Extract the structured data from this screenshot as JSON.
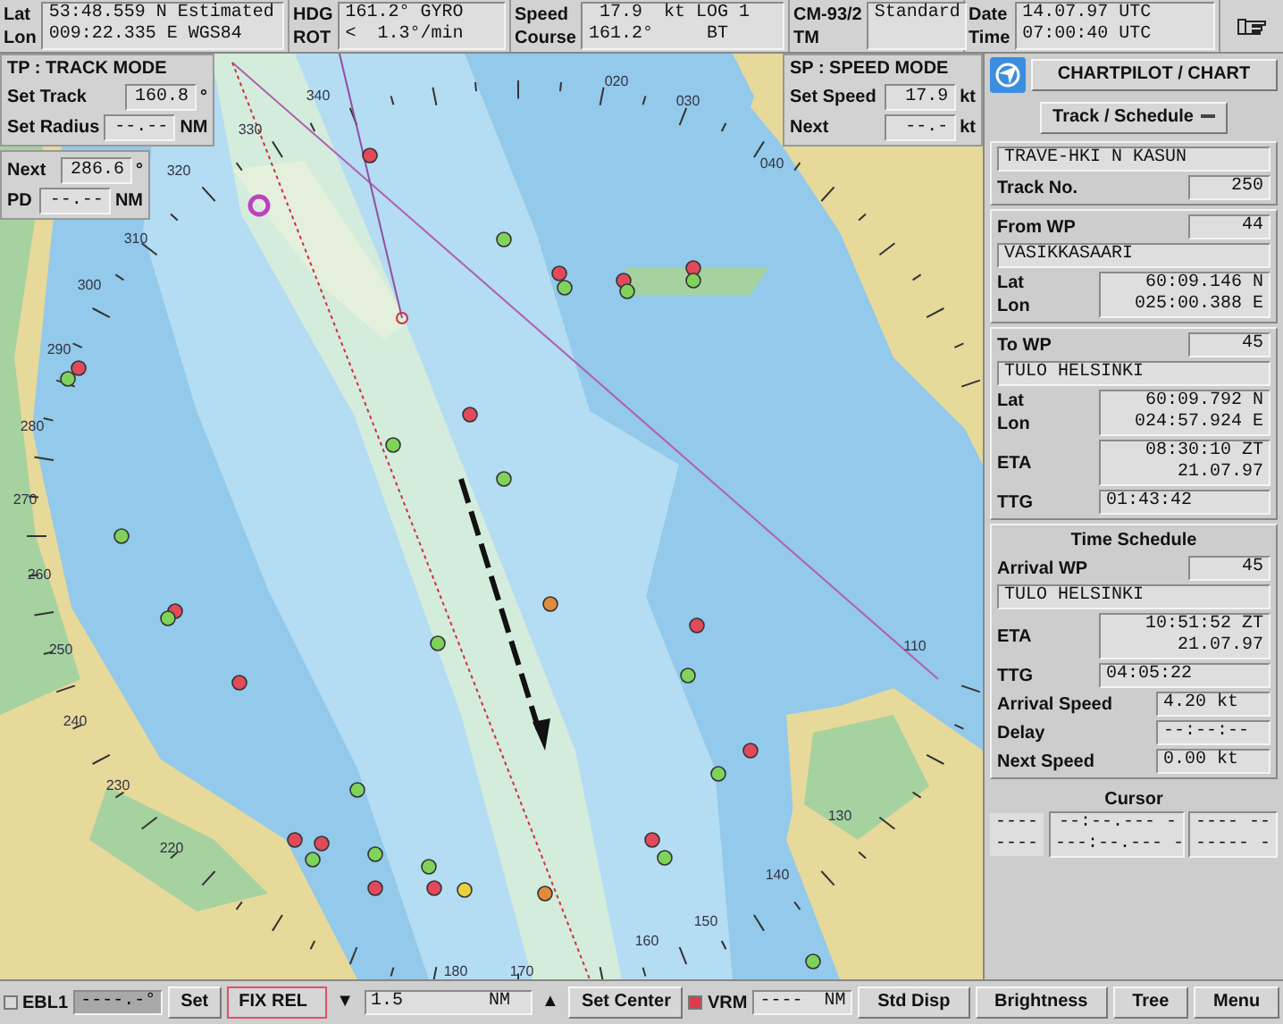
{
  "top_bar": [
    {
      "labels": [
        "Lat",
        "Lon"
      ],
      "values": [
        "53:48.559 N Estimated",
        "009:22.335 E WGS84"
      ]
    },
    {
      "labels": [
        "HDG",
        "ROT"
      ],
      "values": [
        "161.2° GYRO",
        "<  1.3°/min"
      ]
    },
    {
      "labels": [
        "Speed",
        "Course"
      ],
      "values": [
        " 17.9  kt LOG 1",
        "161.2°     BT"
      ]
    },
    {
      "labels": [
        "CM-93/2",
        "TM"
      ],
      "values": [
        "Standard"
      ]
    },
    {
      "labels": [
        "Date",
        "Time"
      ],
      "values": [
        "14.07.97 UTC",
        "07:00:40 UTC"
      ]
    }
  ],
  "track_mode": {
    "title": "TP :  TRACK MODE",
    "rows": [
      {
        "label": "Set Track",
        "value": "160.8",
        "unit": "°"
      },
      {
        "label": "Set Radius",
        "value": "--.--",
        "unit": "NM"
      }
    ]
  },
  "next_panel": {
    "next": {
      "label": "Next",
      "value": "286.6",
      "unit": "°"
    },
    "pd": {
      "label": "PD",
      "value": "--.--",
      "unit": "NM"
    }
  },
  "speed_mode": {
    "title": "SP : SPEED MODE",
    "rows": [
      {
        "label": "Set Speed",
        "value": "17.9",
        "unit": "kt"
      },
      {
        "label": "Next",
        "value": "--.-",
        "unit": "kt"
      }
    ]
  },
  "compass_labels": [
    "340",
    "330",
    "320",
    "310",
    "300",
    "290",
    "280",
    "270",
    "260",
    "250",
    "240",
    "230",
    "220",
    "020",
    "030",
    "040",
    "110",
    "130",
    "140",
    "150",
    "160",
    "170",
    "180"
  ],
  "chartpilot": {
    "title": "CHARTPILOT / CHART",
    "dropdown": "Track / Schedule"
  },
  "track": {
    "name": "TRAVE-HKI N KASUN",
    "number_label": "Track No.",
    "number": "250"
  },
  "from_wp": {
    "label": "From WP",
    "number": "44",
    "name": "VASIKKASAARI",
    "lat_label": "Lat",
    "lon_label": "Lon",
    "lat": "60:09.146 N",
    "lon": "025:00.388 E"
  },
  "to_wp": {
    "label": "To WP",
    "number": "45",
    "name": "TULO HELSINKI",
    "lat_label": "Lat",
    "lon_label": "Lon",
    "lat": "60:09.792 N",
    "lon": "024:57.924 E",
    "eta_label": "ETA",
    "eta": [
      "08:30:10 ZT",
      "21.07.97"
    ],
    "ttg_label": "TTG",
    "ttg": "01:43:42"
  },
  "time_schedule": {
    "title": "Time Schedule",
    "arrival_label": "Arrival WP",
    "arrival_wp": "45",
    "name": "TULO HELSINKI",
    "eta_label": "ETA",
    "eta": [
      "10:51:52 ZT",
      "21.07.97"
    ],
    "ttg_label": "TTG",
    "ttg": "04:05:22",
    "rows": [
      {
        "label": "Arrival Speed",
        "value": "4.20 kt"
      },
      {
        "label": "Delay",
        "value": "--:--:--"
      },
      {
        "label": "Next Speed",
        "value": "0.00 kt"
      }
    ]
  },
  "cursor": {
    "title": "Cursor",
    "labels": [
      "----",
      "----"
    ],
    "values": [
      "--:--.--- -",
      "---:--.--- -"
    ],
    "extra": [
      "---- --",
      "----- -"
    ]
  },
  "bottom_bar": {
    "ebl": {
      "label": "EBL1",
      "checked": false,
      "value": "----.-°"
    },
    "set_button": "Set",
    "fix_rel": "FIX REL",
    "range_down": "▼",
    "range": "1.5",
    "range_unit": "NM",
    "range_up": "▲",
    "set_center": "Set Center",
    "vrm": {
      "label": "VRM",
      "checked": true,
      "value": "----",
      "unit": "NM"
    },
    "buttons": [
      "Std Disp",
      "Brightness",
      "Tree",
      "Menu"
    ]
  }
}
